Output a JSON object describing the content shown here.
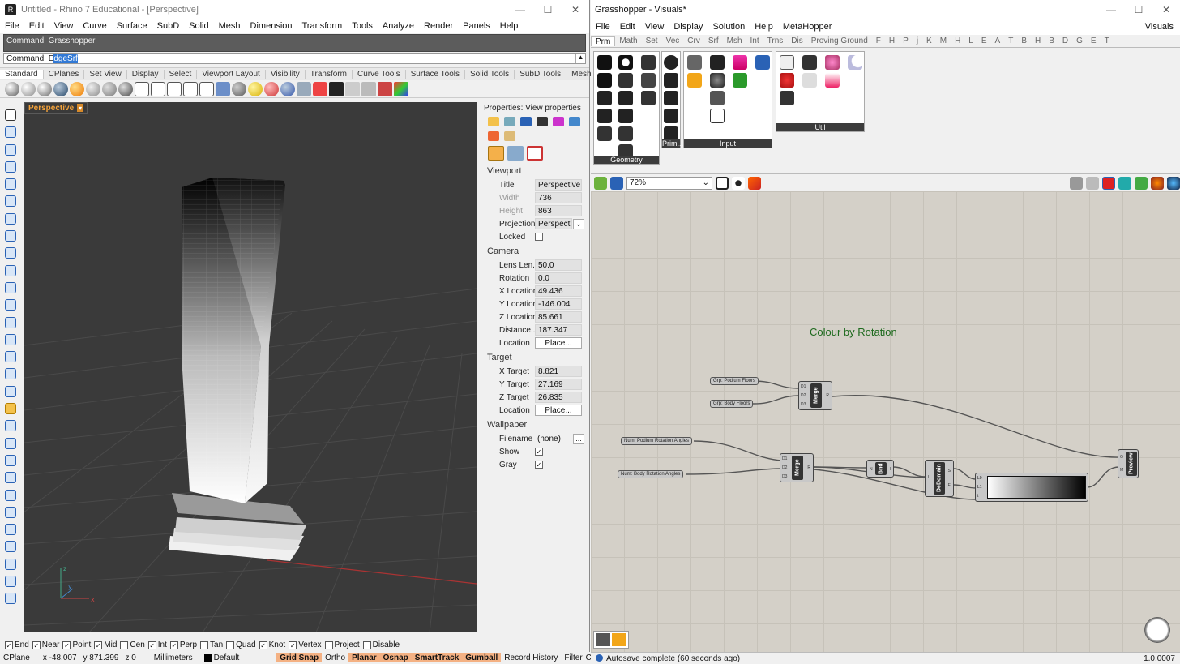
{
  "rhino": {
    "title": "Untitled - Rhino 7 Educational - [Perspective]",
    "menu": [
      "File",
      "Edit",
      "View",
      "Curve",
      "Surface",
      "SubD",
      "Solid",
      "Mesh",
      "Dimension",
      "Transform",
      "Tools",
      "Analyze",
      "Render",
      "Panels",
      "Help"
    ],
    "command_history": "Command: Grasshopper",
    "command_prompt": "Command:",
    "command_pre": "E",
    "command_selected": "dgeSrf",
    "toolbar_tabs": [
      "Standard",
      "CPlanes",
      "Set View",
      "Display",
      "Select",
      "Viewport Layout",
      "Visibility",
      "Transform",
      "Curve Tools",
      "Surface Tools",
      "Solid Tools",
      "SubD Tools",
      "Mesh"
    ],
    "viewport_label": "Perspective",
    "properties": {
      "title": "Properties: View properties",
      "viewport_section": "Viewport",
      "title_label": "Title",
      "title_value": "Perspective",
      "width_label": "Width",
      "width_value": "736",
      "height_label": "Height",
      "height_value": "863",
      "projection_label": "Projection",
      "projection_value": "Perspect...",
      "locked_label": "Locked",
      "camera_section": "Camera",
      "lens_label": "Lens Len...",
      "lens_value": "50.0",
      "rotation_label": "Rotation",
      "rotation_value": "0.0",
      "xloc_label": "X Location",
      "xloc_value": "49.436",
      "yloc_label": "Y Location",
      "yloc_value": "-146.004",
      "zloc_label": "Z Location",
      "zloc_value": "85.661",
      "dist_label": "Distance...",
      "dist_value": "187.347",
      "location_label": "Location",
      "place_button": "Place...",
      "target_section": "Target",
      "xtarget_label": "X Target",
      "xtarget_value": "8.821",
      "ytarget_label": "Y Target",
      "ytarget_value": "27.169",
      "ztarget_label": "Z Target",
      "ztarget_value": "26.835",
      "wallpaper_section": "Wallpaper",
      "filename_label": "Filename",
      "filename_value": "(none)",
      "show_label": "Show",
      "gray_label": "Gray"
    },
    "osnaps": [
      {
        "label": "End",
        "checked": true
      },
      {
        "label": "Near",
        "checked": true
      },
      {
        "label": "Point",
        "checked": true
      },
      {
        "label": "Mid",
        "checked": true
      },
      {
        "label": "Cen",
        "checked": false
      },
      {
        "label": "Int",
        "checked": true
      },
      {
        "label": "Perp",
        "checked": true
      },
      {
        "label": "Tan",
        "checked": false
      },
      {
        "label": "Quad",
        "checked": false
      },
      {
        "label": "Knot",
        "checked": true
      },
      {
        "label": "Vertex",
        "checked": true
      },
      {
        "label": "Project",
        "checked": false
      },
      {
        "label": "Disable",
        "checked": false
      }
    ],
    "status": {
      "cplane": "CPlane",
      "x": "x -48.007",
      "y": "y 871.399",
      "z": "z 0",
      "units": "Millimeters",
      "layer": "Default",
      "grid_snap": "Grid Snap",
      "ortho": "Ortho",
      "planar": "Planar",
      "osnap": "Osnap",
      "smarttrack": "SmartTrack",
      "gumball": "Gumball",
      "record_history": "Record History",
      "filter": "Filter",
      "trailing": "C"
    }
  },
  "gh": {
    "title": "Grasshopper - Visuals*",
    "menu": [
      "File",
      "Edit",
      "View",
      "Display",
      "Solution",
      "Help",
      "MetaHopper"
    ],
    "doc_name": "Visuals",
    "tabs": [
      "Prm",
      "Math",
      "Set",
      "Vec",
      "Crv",
      "Srf",
      "Msh",
      "Int",
      "Trns",
      "Dis",
      "Proving Ground",
      "F",
      "H",
      "P",
      "j",
      "K",
      "M",
      "H",
      "L",
      "E",
      "A",
      "T",
      "B",
      "H",
      "B",
      "D",
      "G",
      "E",
      "T"
    ],
    "panels": {
      "geometry": "Geometry",
      "primitive": "Prim...",
      "input": "Input",
      "util": "Util"
    },
    "zoom": "72%",
    "canvas_title": "Colour by Rotation",
    "params": {
      "podium_floors": "Grp: Podium Floors",
      "body_floors": "Grp: Body Floors",
      "podium_angles": "Num: Podium Rotation Angles",
      "body_angles": "Num: Body Rotation Angles"
    },
    "components": {
      "merge1": "Merge",
      "merge2": "Merge",
      "bnd": "Bnd",
      "dedomain": "DeDomain",
      "preview": "Preview"
    },
    "status": "Autosave complete (60 seconds ago)",
    "version": "1.0.0007"
  }
}
